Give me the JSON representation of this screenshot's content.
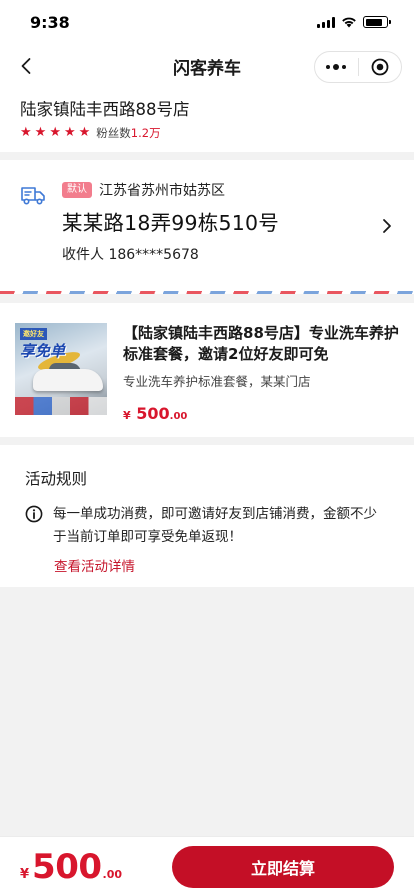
{
  "status": {
    "time": "9:38"
  },
  "nav": {
    "title": "闪客养车"
  },
  "shop": {
    "name": "陆家镇陆丰西路88号店",
    "fans_label": "粉丝数",
    "fans_count": "1.2万",
    "rating": 5
  },
  "address": {
    "badge": "默认",
    "region": "江苏省苏州市姑苏区",
    "street": "某某路18弄99栋510号",
    "recipient": "收件人 186****5678"
  },
  "product": {
    "image_tag_top": "邀好友",
    "image_tag_main": "享免单",
    "title": "【陆家镇陆丰西路88号店】专业洗车养护标准套餐，邀请2位好友即可免",
    "desc": "专业洗车养护标准套餐，某某门店",
    "price_symbol": "¥",
    "price_int": "500",
    "price_dec": ".00"
  },
  "rules": {
    "title": "活动规则",
    "text": "每一单成功消费，即可邀请好友到店铺消费，金额不少于当前订单即可享受免单返现！",
    "link": "查看活动详情"
  },
  "footer": {
    "price_symbol": "¥",
    "price_int": "500",
    "price_dec": ".00",
    "checkout_label": "立即结算"
  },
  "colors": {
    "accent": "#d8162d",
    "button": "#c40f26",
    "badge": "#f27d8d",
    "truck": "#3f79d6"
  },
  "icons": [
    "back-arrow-icon",
    "more-dots-icon",
    "close-target-icon",
    "star-icon",
    "truck-icon",
    "chevron-right-icon",
    "info-icon"
  ]
}
